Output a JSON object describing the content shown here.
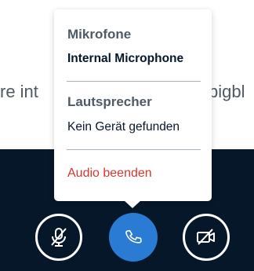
{
  "background": {
    "text_left": "re int",
    "text_right": "pigbl"
  },
  "audio_menu": {
    "microphone_title": "Mikrofone",
    "microphone_selected": "Internal Microphone",
    "speaker_title": "Lautsprecher",
    "speaker_option": "Kein Gerät gefunden",
    "end_audio_label": "Audio beenden"
  },
  "controls": {
    "mute_icon": "microphone-muted-icon",
    "audio_icon": "phone-icon",
    "video_icon": "camera-off-icon"
  },
  "colors": {
    "dark_bar": "#06172a",
    "primary_button": "#2a7bd3",
    "danger_text": "#d9362d",
    "muted_text": "#4e5a66"
  }
}
